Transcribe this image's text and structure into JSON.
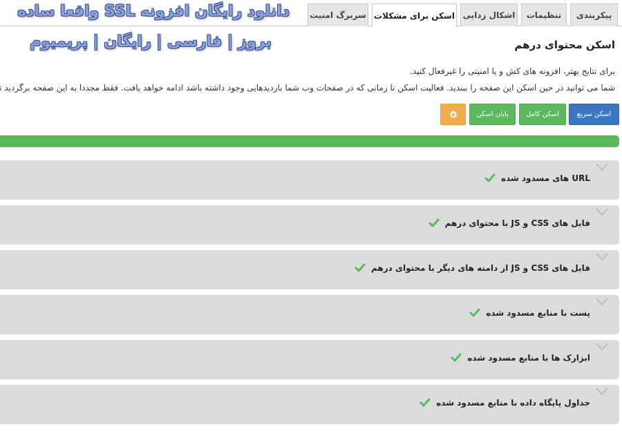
{
  "tabs": [
    {
      "label": "پیکربندی",
      "active": false
    },
    {
      "label": "تنظیمات",
      "active": false
    },
    {
      "label": "اشکال زدایی",
      "active": false
    },
    {
      "label": "اسکن برای مشکلات",
      "active": true
    },
    {
      "label": "سربرگ امنیت",
      "active": false
    }
  ],
  "watermark": {
    "line1": "دانلود رایگان افزونه SSL واقعا ساده",
    "line2": "بروز | فارسی | رایگان | پریمیوم"
  },
  "section": {
    "title": "اسکن محتوای درهم",
    "desc1": "برای نتایج بهتر، افزونه های کش و یا امنیتی را غیرفعال کنید.",
    "desc2": "شما می توانید در حین اسکن این صفحه را ببندید. فعالیت اسکن تا زمانی که در صفحات وب شما بازدیدهایی وجود داشته باشد ادامه خواهد یافت. فقط مجددا به این صفحه برگردید تا"
  },
  "buttons": {
    "quick_scan": "اسکن سریع",
    "full_scan": "اسکن کامل",
    "end_scan": "پایان اسکن",
    "settings_icon": "gear-icon"
  },
  "progress": {
    "percent": 100,
    "color": "#5cb85c"
  },
  "panels": [
    {
      "title": "URL های مسدود شده",
      "status_icon": "check-icon"
    },
    {
      "title": "فایل های CSS و JS با محتوای درهم",
      "status_icon": "check-icon"
    },
    {
      "title": "فایل های CSS و JS از دامنه های دیگر با محتوای درهم",
      "status_icon": "check-icon"
    },
    {
      "title": "پست با منابع مسدود شده",
      "status_icon": "check-icon"
    },
    {
      "title": "ابزارک ها با منابع مسدود شده",
      "status_icon": "check-icon"
    },
    {
      "title": "جداول پایگاه داده با منابع مسدود شده",
      "status_icon": "check-icon"
    }
  ],
  "colors": {
    "primary": "#3b78c1",
    "success": "#5cb85c",
    "warning": "#f0ad4e",
    "panel_bg": "#dcdcdc"
  }
}
